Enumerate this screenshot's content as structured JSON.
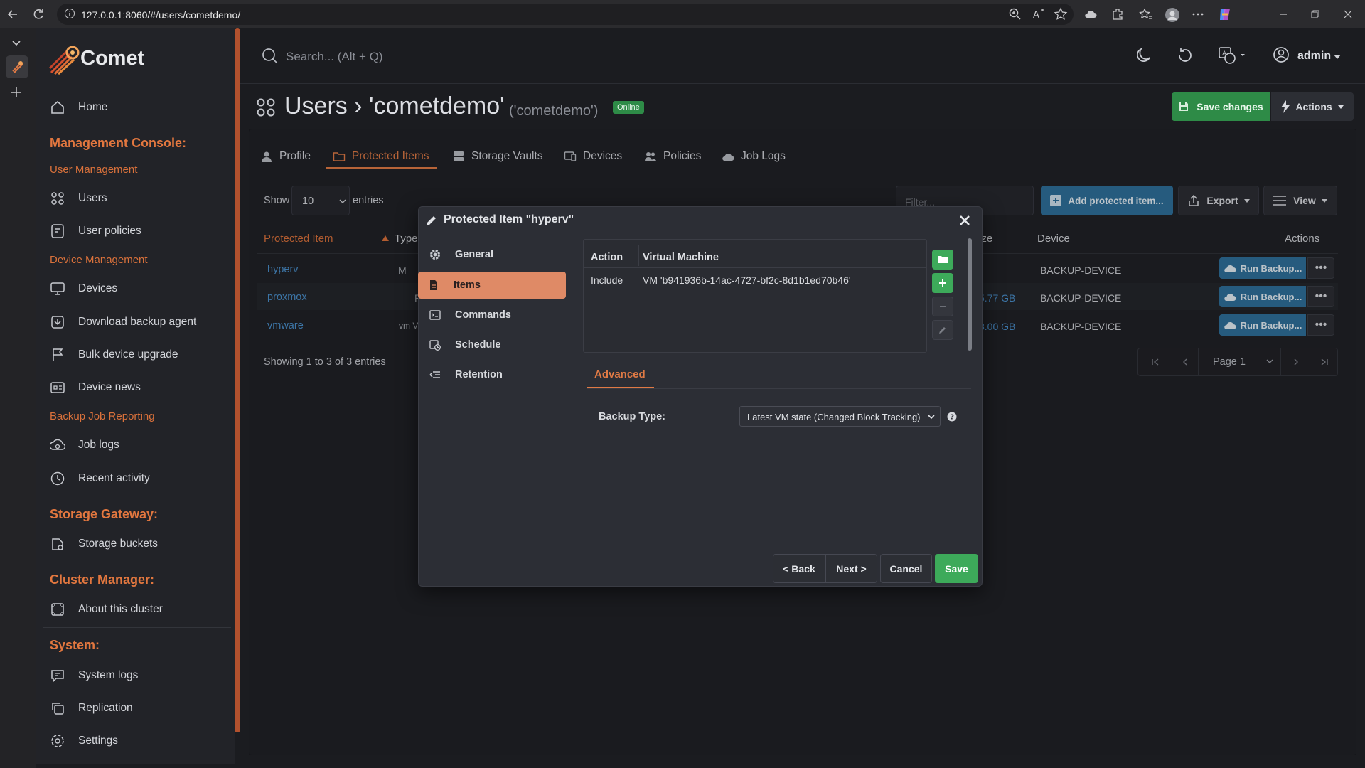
{
  "browser": {
    "url": "127.0.0.1:8060/#/users/cometdemo/"
  },
  "app": {
    "logo_text": "Comet"
  },
  "sidebar": {
    "home": "Home",
    "management_console": "Management Console:",
    "user_management": "User Management",
    "users": "Users",
    "user_policies": "User policies",
    "device_management": "Device Management",
    "devices": "Devices",
    "download_agent": "Download backup agent",
    "bulk_upgrade": "Bulk device upgrade",
    "device_news": "Device news",
    "backup_job_reporting": "Backup Job Reporting",
    "job_logs": "Job logs",
    "recent_activity": "Recent activity",
    "storage_gateway": "Storage Gateway:",
    "storage_buckets": "Storage buckets",
    "cluster_manager": "Cluster Manager:",
    "about_cluster": "About this cluster",
    "system": "System:",
    "system_logs": "System logs",
    "replication": "Replication",
    "settings": "Settings"
  },
  "header": {
    "search_placeholder": "Search... (Alt + Q)",
    "user": "admin"
  },
  "page": {
    "title": "Users › 'cometdemo'",
    "subtitle": "('cometdemo')",
    "status": "Online",
    "save_changes": "Save changes",
    "actions": "Actions"
  },
  "tabs": [
    "Profile",
    "Protected Items",
    "Storage Vaults",
    "Devices",
    "Policies",
    "Job Logs"
  ],
  "table": {
    "show": "Show",
    "page_size": "10",
    "entries": "entries",
    "filter_placeholder": "Filter...",
    "add_item": "Add protected item...",
    "export": "Export",
    "view": "View",
    "headers": {
      "item": "Protected Item",
      "type": "Type",
      "size": "ize",
      "device": "Device",
      "actions": "Actions"
    },
    "rows": [
      {
        "name": "hyperv",
        "type": "M",
        "size": "",
        "device": "BACKUP-DEVICE",
        "run": "Run Backup..."
      },
      {
        "name": "proxmox",
        "type": "P",
        "size": "5.77 GB",
        "device": "BACKUP-DEVICE",
        "run": "Run Backup..."
      },
      {
        "name": "vmware",
        "type": "vm V",
        "size": "3.00 GB",
        "device": "BACKUP-DEVICE",
        "run": "Run Backup..."
      }
    ],
    "showing": "Showing 1 to 3 of 3 entries",
    "pager": "Page 1"
  },
  "modal": {
    "title": "Protected Item \"hyperv\"",
    "nav": [
      "General",
      "Items",
      "Commands",
      "Schedule",
      "Retention"
    ],
    "col_action": "Action",
    "col_vm": "Virtual Machine",
    "row_action": "Include",
    "row_vm": "VM 'b941936b-14ac-4727-bf2c-8d1b1ed70b46'",
    "advanced_tab": "Advanced",
    "backup_type_label": "Backup Type:",
    "backup_type_value": "Latest VM state (Changed Block Tracking)",
    "back": "< Back",
    "next": "Next >",
    "cancel": "Cancel",
    "save": "Save"
  },
  "colors": {
    "accent": "#e07a45",
    "primary_blue": "#2f6f9a",
    "success": "#3daa5a"
  }
}
